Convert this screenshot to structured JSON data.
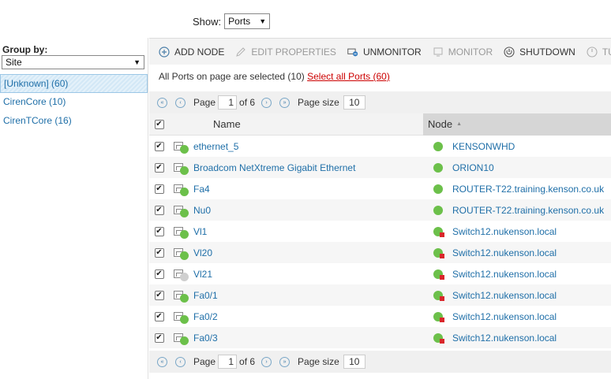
{
  "colors": {
    "up": "#6cc04a",
    "unknown": "#cfcfcf",
    "warning": "#d9262a",
    "link": "#1f6fa8",
    "accent_red": "#cc0000"
  },
  "show": {
    "label": "Show:",
    "value": "Ports"
  },
  "groupby": {
    "label": "Group by:",
    "value": "Site",
    "items": [
      {
        "label": "[Unknown] (60)",
        "selected": true
      },
      {
        "label": "CirenCore (10)",
        "selected": false
      },
      {
        "label": "CirenTCore (16)",
        "selected": false
      }
    ]
  },
  "toolbar": {
    "buttons": [
      {
        "label": "ADD NODE",
        "icon": "add-circle-icon",
        "enabled": true
      },
      {
        "label": "EDIT PROPERTIES",
        "icon": "pencil-icon",
        "enabled": false
      },
      {
        "label": "UNMONITOR",
        "icon": "unmonitor-icon",
        "enabled": true
      },
      {
        "label": "MONITOR",
        "icon": "monitor-icon",
        "enabled": false
      },
      {
        "label": "SHUTDOWN",
        "icon": "power-icon",
        "enabled": true
      },
      {
        "label": "TURN ON",
        "icon": "power-on-icon",
        "enabled": false
      }
    ]
  },
  "selection": {
    "text": "All Ports on page are selected (10)",
    "link": "Select all Ports (60)"
  },
  "pager": {
    "page_label": "Page",
    "page": "1",
    "of": "of 6",
    "size_label": "Page size",
    "size": "10"
  },
  "grid": {
    "col_name": "Name",
    "col_node": "Node",
    "rows": [
      {
        "name": "ethernet_5",
        "port_status": "up",
        "node": "KENSONWHD",
        "node_warning": false
      },
      {
        "name": "Broadcom NetXtreme Gigabit Ethernet",
        "port_status": "up",
        "node": "ORION10",
        "node_warning": false
      },
      {
        "name": "Fa4",
        "port_status": "up",
        "node": "ROUTER-T22.training.kenson.co.uk",
        "node_warning": false
      },
      {
        "name": "Nu0",
        "port_status": "up",
        "node": "ROUTER-T22.training.kenson.co.uk",
        "node_warning": false
      },
      {
        "name": "Vl1",
        "port_status": "up",
        "node": "Switch12.nukenson.local",
        "node_warning": true
      },
      {
        "name": "Vl20",
        "port_status": "up",
        "node": "Switch12.nukenson.local",
        "node_warning": true
      },
      {
        "name": "Vl21",
        "port_status": "unknown",
        "node": "Switch12.nukenson.local",
        "node_warning": true
      },
      {
        "name": "Fa0/1",
        "port_status": "up",
        "node": "Switch12.nukenson.local",
        "node_warning": true
      },
      {
        "name": "Fa0/2",
        "port_status": "up",
        "node": "Switch12.nukenson.local",
        "node_warning": true
      },
      {
        "name": "Fa0/3",
        "port_status": "up",
        "node": "Switch12.nukenson.local",
        "node_warning": true
      }
    ]
  }
}
